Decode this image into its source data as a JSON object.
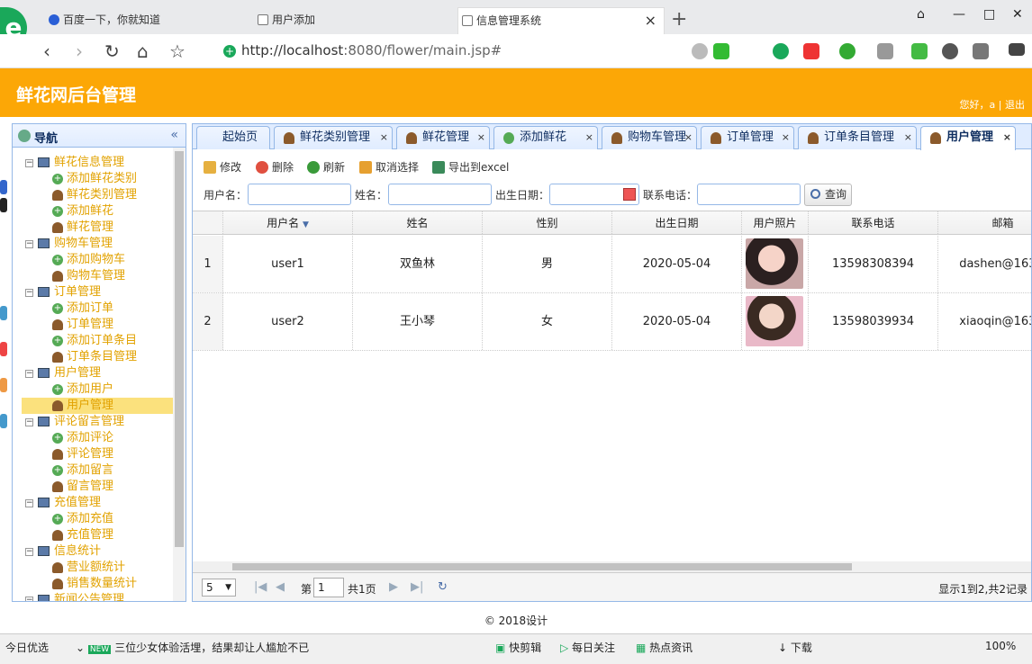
{
  "browser": {
    "tabs": [
      {
        "label": "百度一下，你就知道"
      },
      {
        "label": "用户添加"
      },
      {
        "label": "信息管理系统"
      }
    ],
    "url_host": "http://localhost",
    "url_rest": ":8080/flower/main.jsp#"
  },
  "header": {
    "title": "鲜花网后台管理",
    "user_info": "您好，a | 退出"
  },
  "sidebar": {
    "title": "导航",
    "tree": [
      {
        "label": "鲜花信息管理",
        "children": [
          "添加鲜花类别",
          "鲜花类别管理",
          "添加鲜花",
          "鲜花管理"
        ]
      },
      {
        "label": "购物车管理",
        "children": [
          "添加购物车",
          "购物车管理"
        ]
      },
      {
        "label": "订单管理",
        "children": [
          "添加订单",
          "订单管理",
          "添加订单条目",
          "订单条目管理"
        ]
      },
      {
        "label": "用户管理",
        "children": [
          "添加用户",
          "用户管理"
        ]
      },
      {
        "label": "评论留言管理",
        "children": [
          "添加评论",
          "评论管理",
          "添加留言",
          "留言管理"
        ]
      },
      {
        "label": "充值管理",
        "children": [
          "添加充值",
          "充值管理"
        ]
      },
      {
        "label": "信息统计",
        "children": [
          "营业额统计",
          "销售数量统计"
        ]
      },
      {
        "label": "新闻公告管理",
        "children": []
      }
    ]
  },
  "tabs": [
    "起始页",
    "鲜花类别管理",
    "鲜花管理",
    "添加鲜花",
    "购物车管理",
    "订单管理",
    "订单条目管理",
    "用户管理"
  ],
  "toolbar": {
    "edit": "修改",
    "delete": "删除",
    "refresh": "刷新",
    "cancel_select": "取消选择",
    "export": "导出到excel"
  },
  "search": {
    "username_label": "用户名：",
    "name_label": "姓名：",
    "birth_label": "出生日期：",
    "phone_label": "联系电话：",
    "query": "查询"
  },
  "grid": {
    "columns": [
      "用户名",
      "姓名",
      "性别",
      "出生日期",
      "用户照片",
      "联系电话",
      "邮箱"
    ],
    "rows": [
      {
        "n": "1",
        "username": "user1",
        "name": "双鱼林",
        "gender": "男",
        "birth": "2020-05-04",
        "phone": "13598308394",
        "email": "dashen@163.c"
      },
      {
        "n": "2",
        "username": "user2",
        "name": "王小琴",
        "gender": "女",
        "birth": "2020-05-04",
        "phone": "13598039934",
        "email": "xiaoqin@163.c"
      }
    ]
  },
  "pager": {
    "page_size": "5",
    "page_prefix": "第",
    "page_value": "1",
    "page_suffix": "共1页",
    "summary": "显示1到2,共2记录"
  },
  "footer": "© 2018设计",
  "statusbar": {
    "left": "今日优选",
    "news_badge": "NEW",
    "news": "三位少女体验活埋，结果却让人尴尬不已",
    "items": [
      "快剪辑",
      "每日关注",
      "热点资讯",
      "下载"
    ],
    "zoom": "100%"
  }
}
